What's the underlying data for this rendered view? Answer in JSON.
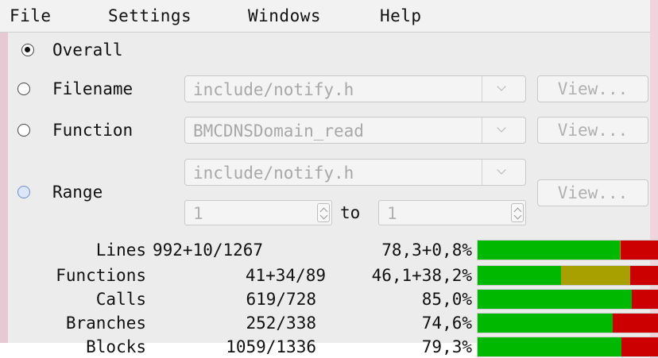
{
  "menu": [
    "File",
    "Settings",
    "Windows",
    "Help"
  ],
  "scope": {
    "overall": "Overall",
    "filename": {
      "label": "Filename",
      "value": "include/notify.h",
      "button": "View..."
    },
    "function": {
      "label": "Function",
      "value": "BMCDNSDomain_read",
      "button": "View..."
    },
    "range": {
      "label": "Range",
      "file": "include/notify.h",
      "from": "1",
      "to_label": "to",
      "to": "1",
      "button": "View..."
    }
  },
  "stats": [
    {
      "name": "Lines",
      "count": "992+10/1267",
      "percent": "78,3+0,8%",
      "covered": 78.3,
      "partial": 0.8
    },
    {
      "name": "Functions",
      "count": "41+34/89",
      "percent": "46,1+38,2%",
      "covered": 46.1,
      "partial": 38.2
    },
    {
      "name": "Calls",
      "count": "619/728",
      "percent": "85,0%",
      "covered": 85.0,
      "partial": 0
    },
    {
      "name": "Branches",
      "count": "252/338",
      "percent": "74,6%",
      "covered": 74.6,
      "partial": 0
    },
    {
      "name": "Blocks",
      "count": "1059/1336",
      "percent": "79,3%",
      "covered": 79.3,
      "partial": 0
    }
  ],
  "colors": {
    "covered": "#00b800",
    "partial": "#a8a000",
    "uncovered": "#cc0000"
  }
}
